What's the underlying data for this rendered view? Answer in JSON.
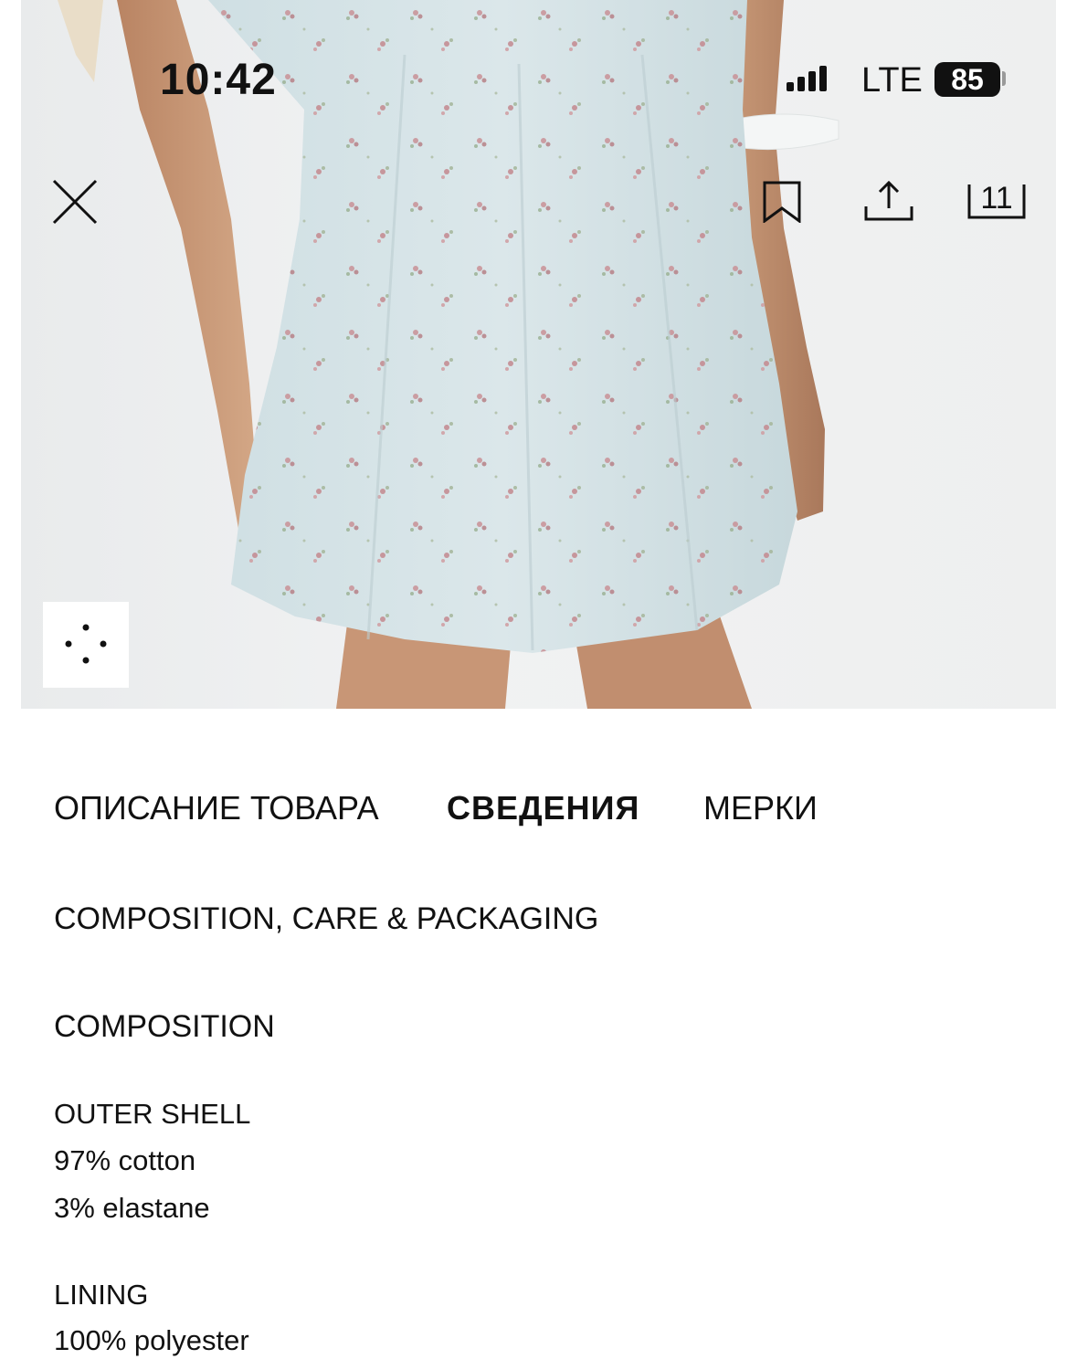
{
  "status_bar": {
    "time": "10:42",
    "network": "LTE",
    "battery": "85"
  },
  "toolbar": {
    "image_count": "11"
  },
  "tabs": [
    {
      "label": "ОПИСАНИЕ ТОВАРА",
      "active": false
    },
    {
      "label": "СВЕДЕНИЯ",
      "active": true
    },
    {
      "label": "МЕРКИ",
      "active": false
    }
  ],
  "details": {
    "care_heading": "COMPOSITION, CARE & PACKAGING",
    "composition_heading": "COMPOSITION",
    "outer_shell_label": "OUTER SHELL",
    "outer_shell": [
      "97% cotton",
      "3% elastane"
    ],
    "lining_label": "LINING",
    "lining": [
      "100% polyester"
    ]
  },
  "icons": {
    "close": "close-icon",
    "bookmark": "bookmark-icon",
    "share": "share-icon",
    "zoom": "zoom-dots-icon"
  },
  "colors": {
    "dress": "#d5e3e6",
    "skin": "#c99a7a",
    "text": "#111111"
  }
}
